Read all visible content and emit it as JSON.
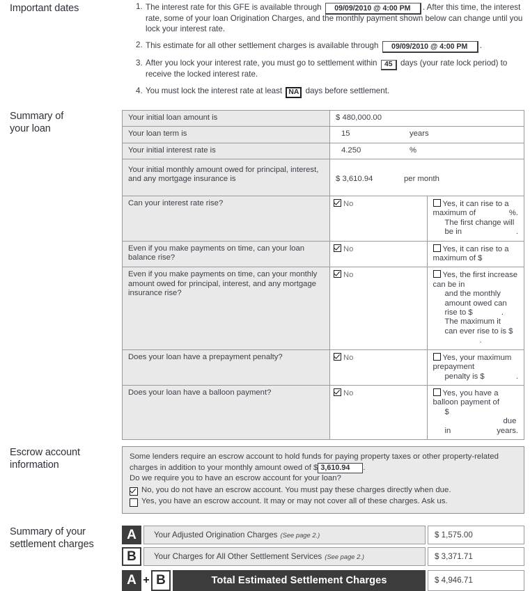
{
  "important_dates": {
    "section_label": "Important dates",
    "items": [
      {
        "number": "1.",
        "text_before": "The interest rate for this GFE is available through",
        "boxed_value": "09/09/2010 @ 4:00 PM",
        "text_after": ". After this time, the interest rate, some of your loan Origination Charges, and the monthly payment shown below can change until you lock your interest rate."
      },
      {
        "number": "2.",
        "text_before": "This estimate for all other settlement charges is available through",
        "boxed_value": "09/09/2010 @ 4:00 PM",
        "text_after": "."
      },
      {
        "number": "3.",
        "text_before": "After you lock your interest rate, you must go to settlement within",
        "boxed_value": "45",
        "text_after": "days (your rate lock period) to receive the locked interest rate."
      },
      {
        "number": "4.",
        "text_before": "You must lock the interest rate at least",
        "boxed_value": "NA",
        "text_after": "days before settlement."
      }
    ]
  },
  "summary_of_loan": {
    "section_label_line1": "Summary of",
    "section_label_line2": "your loan",
    "rows": {
      "loan_amount": {
        "question": "Your initial loan amount is",
        "currency_symbol": "$",
        "value": "480,000.00"
      },
      "loan_term": {
        "question": "Your loan term is",
        "value": "15",
        "unit": "years"
      },
      "interest_rate": {
        "question": "Your initial interest rate is",
        "value": "4.250",
        "unit": "%"
      },
      "monthly_amount": {
        "question": "Your initial monthly amount owed for principal, interest, and any mortgage insurance is",
        "currency_symbol": "$",
        "value": "3,610.94",
        "unit": "per month"
      },
      "rate_rise": {
        "question": "Can your interest rate rise?",
        "no_label": "No",
        "no_checked": true,
        "yes_checked": false,
        "yes_line1": "Yes, it can rise to a maximum of",
        "yes_line1_suffix": "%.",
        "yes_line2": "The first change will be in",
        "yes_line2_suffix": "."
      },
      "balance_rise": {
        "question": "Even if you make payments on time, can your loan balance rise?",
        "no_label": "No",
        "no_checked": true,
        "yes_checked": false,
        "yes_line1": "Yes, it can rise to a maximum of $"
      },
      "payment_rise": {
        "question": "Even if you make payments on time, can your monthly amount owed for principal, interest, and any mortgage insurance rise?",
        "no_label": "No",
        "no_checked": true,
        "yes_checked": false,
        "yes_line1": "Yes, the first increase can be in",
        "yes_line2": "and the monthly amount owed can",
        "yes_line3": "rise to  $",
        "yes_line3_suffix": ". The maximum it",
        "yes_line4": "can ever rise to is $",
        "yes_line4_suffix": "."
      },
      "prepayment_penalty": {
        "question": "Does your loan have a prepayment penalty?",
        "no_label": "No",
        "no_checked": true,
        "yes_checked": false,
        "yes_line1": "Yes, your maximum prepayment",
        "yes_line2": "penalty is $",
        "yes_line2_suffix": "."
      },
      "balloon_payment": {
        "question": "Does your loan have a balloon payment?",
        "no_label": "No",
        "no_checked": true,
        "yes_checked": false,
        "yes_line1": "Yes, you have a balloon payment of",
        "yes_line2_currency": "$",
        "yes_line2_mid": "due in",
        "yes_line2_suffix": "years."
      }
    }
  },
  "escrow": {
    "section_label_line1": "Escrow account",
    "section_label_line2": "information",
    "intro_before": "Some lenders require an escrow account to hold funds for paying property taxes or other property-related charges in addition to your monthly amount owed of $",
    "monthly_amount": "3,610.94",
    "intro_after": ".",
    "question": "Do we require you to have an escrow account for your loan?",
    "option_no": {
      "checked": true,
      "text": "No, you do not have an escrow account. You must pay these charges directly when due."
    },
    "option_yes": {
      "checked": false,
      "text": "Yes, you have an escrow account. It may or may not cover all of these charges. Ask us."
    }
  },
  "settlement_charges": {
    "section_label_line1": "Summary of your",
    "section_label_line2": "settlement charges",
    "row_a": {
      "badge": "A",
      "description": "Your Adjusted Origination Charges",
      "note": "(See page 2.)",
      "amount": "$ 1,575.00"
    },
    "row_b": {
      "badge": "B",
      "description": "Your Charges for All Other Settlement Services",
      "note": "(See page 2.)",
      "amount": "$ 3,371.71"
    },
    "row_total": {
      "badge_a": "A",
      "plus": "+",
      "badge_b": "B",
      "title": "Total Estimated Settlement Charges",
      "amount": "$ 4,946.71"
    }
  },
  "colors": {
    "text": "#3d3e48",
    "header_text": "#2f3038",
    "table_border": "#9a9a9e",
    "row_shade": "#e9e9e9",
    "dark_badge": "#3c3c3c",
    "page_background": "#ffffff"
  }
}
